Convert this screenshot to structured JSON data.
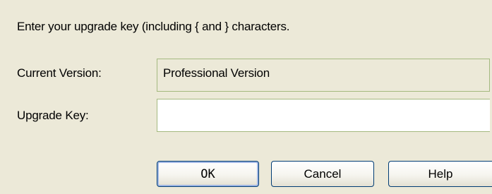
{
  "dialog": {
    "prompt": "Enter your upgrade key (including { and } characters.",
    "current_version": {
      "label": "Current Version:",
      "value": "Professional Version"
    },
    "upgrade_key": {
      "label": "Upgrade Key:",
      "value": ""
    },
    "buttons": {
      "ok": "OK",
      "cancel": "Cancel",
      "help": "Help"
    }
  }
}
